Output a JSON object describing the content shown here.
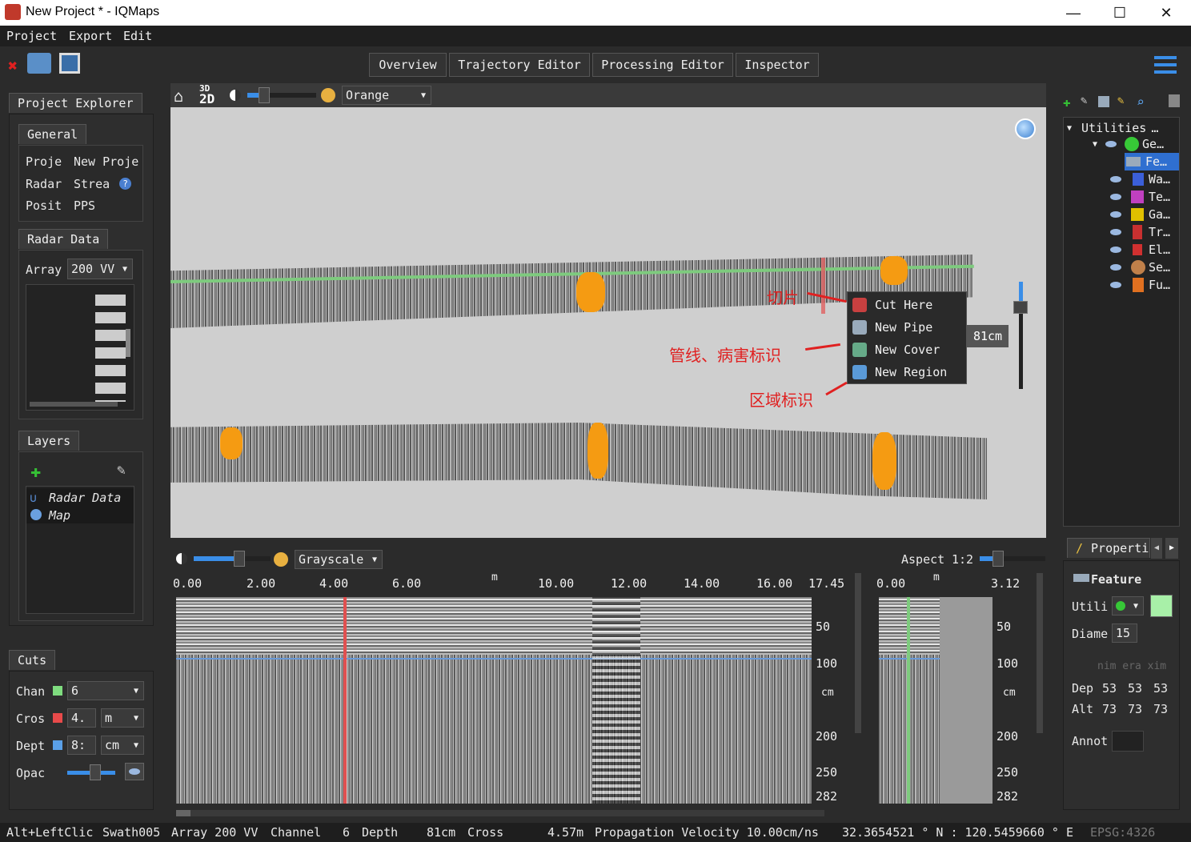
{
  "window": {
    "title": "New Project * - IQMaps",
    "minimize": "—",
    "maximize": "☐",
    "close": "✕"
  },
  "menu": [
    "Project",
    "Export",
    "Edit"
  ],
  "tabs": [
    "Overview",
    "Trajectory Editor",
    "Processing Editor",
    "Inspector"
  ],
  "project_explorer": {
    "title": "Project Explorer",
    "general_tab": "General",
    "rows": [
      [
        "Proje",
        "New Proje"
      ],
      [
        "Radar",
        "Strea"
      ],
      [
        "Posit",
        "PPS"
      ]
    ],
    "radar_tab": "Radar Data",
    "array_label": "Array",
    "array_value": "200 VV"
  },
  "layers": {
    "title": "Layers",
    "items": [
      "Radar Data",
      "Map"
    ]
  },
  "cuts": {
    "title": "Cuts",
    "chan_label": "Chan",
    "chan_value": "6",
    "cross_label": "Cros",
    "cross_value": "4.",
    "cross_unit": "m",
    "depth_label": "Dept",
    "depth_value": "8:",
    "depth_unit": "cm",
    "opac_label": "Opac"
  },
  "map_view": {
    "colormap": "Orange",
    "badge_3d": "3D",
    "badge_2d": "2D",
    "depth_badge": "81cm",
    "context_menu": [
      "Cut Here",
      "New Pipe",
      "New Cover",
      "New Region"
    ],
    "annotations": [
      "切片",
      "管线、病害标识",
      "区域标识"
    ]
  },
  "profile": {
    "colormap": "Grayscale",
    "aspect_label": "Aspect",
    "aspect_value": "1:2",
    "x_ticks": [
      "0.00",
      "2.00",
      "4.00",
      "6.00",
      "m",
      "10.00",
      "12.00",
      "14.00",
      "16.00",
      "17.45"
    ],
    "y_ticks": [
      "50",
      "100",
      "cm",
      "200",
      "250",
      "282"
    ],
    "cross_ticks": [
      "0.00",
      "m",
      "3.12"
    ]
  },
  "utilities": {
    "title": "Utilities",
    "items": [
      "Ge…",
      "Fe…",
      "Wa…",
      "Te…",
      "Ga…",
      "Tr…",
      "El…",
      "Se…",
      "Fu…"
    ],
    "item_colors": [
      "#37c837",
      "#4a90d9",
      "#3b5fd9",
      "#c040c0",
      "#e0c000",
      "#c83030",
      "#d03030",
      "#c0804a",
      "#e07020"
    ]
  },
  "properties": {
    "title": "Properti",
    "feature": "Feature",
    "util_label": "Utili",
    "diam_label": "Diame",
    "diam_value": "15",
    "header": "nim era xim",
    "dep_label": "Dep",
    "dep_values": [
      "53",
      "53",
      "53"
    ],
    "alt_label": "Alt",
    "alt_values": [
      "73",
      "73",
      "73"
    ],
    "annot_label": "Annot"
  },
  "status": {
    "hint": "Alt+LeftClic",
    "swath": "Swath005",
    "array": "Array 200 VV",
    "channel": "Channel",
    "channel_value": "6",
    "depth": "Depth",
    "depth_value": "81cm",
    "cross": "Cross",
    "cross_value": "4.57m",
    "velocity": "Propagation Velocity 10.00cm/ns",
    "coords": "32.3654521 ° N : 120.5459660 ° E",
    "epsg": "EPSG:4326"
  }
}
